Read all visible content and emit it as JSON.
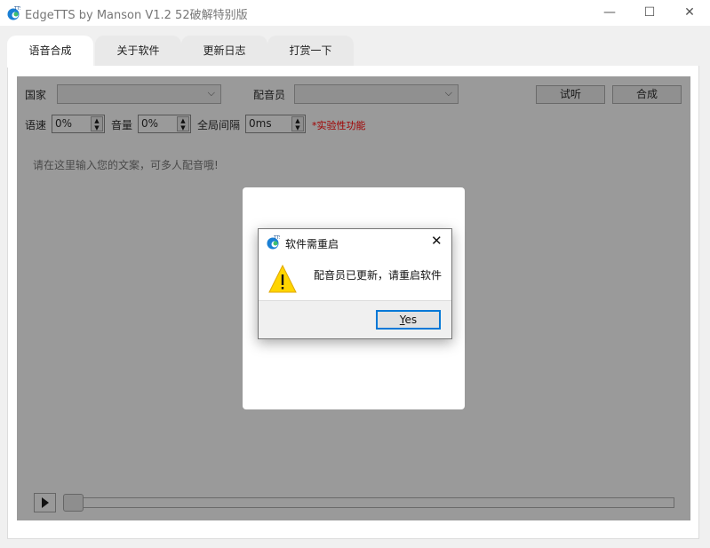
{
  "window": {
    "title": "EdgeTTS by Manson V1.2 52破解特别版",
    "minimize": "—",
    "maximize": "☐",
    "close": "✕"
  },
  "tabs": [
    {
      "label": "语音合成"
    },
    {
      "label": "关于软件"
    },
    {
      "label": "更新日志"
    },
    {
      "label": "打赏一下"
    }
  ],
  "controls": {
    "country_label": "国家",
    "country_value": "",
    "voice_label": "配音员",
    "voice_value": "",
    "listen_button": "试听",
    "synth_button": "合成",
    "speed_label": "语速",
    "speed_value": "0%",
    "volume_label": "音量",
    "volume_value": "0%",
    "interval_label": "全局间隔",
    "interval_value": "0ms",
    "experimental_note": "*实验性功能",
    "text_placeholder": "请在这里输入您的文案，可多人配音哦!"
  },
  "player": {
    "progress": 0
  },
  "dialog": {
    "title": "软件需重启",
    "message": "配音员已更新，请重启软件",
    "yes_button": "Yes",
    "icon": "warning-icon"
  },
  "colors": {
    "accent": "#0078d7",
    "note": "#c00000"
  }
}
